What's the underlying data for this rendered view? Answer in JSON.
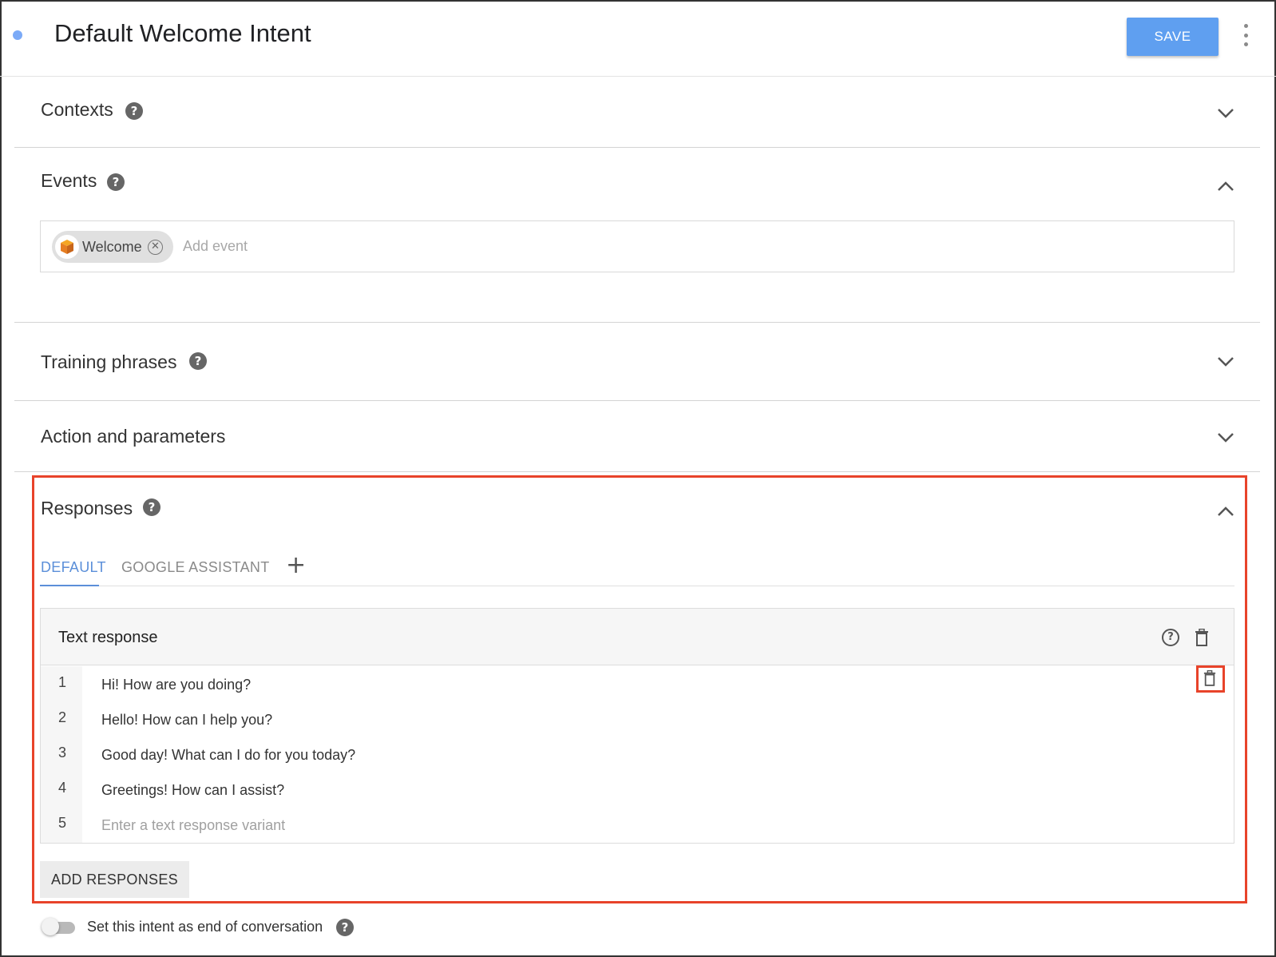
{
  "header": {
    "title": "Default Welcome Intent",
    "save_label": "SAVE"
  },
  "sections": {
    "contexts": "Contexts",
    "events": "Events",
    "training": "Training phrases",
    "action": "Action and parameters",
    "responses": "Responses"
  },
  "events": {
    "chip_label": "Welcome",
    "add_placeholder": "Add event"
  },
  "responses": {
    "tabs": [
      "DEFAULT",
      "GOOGLE ASSISTANT"
    ],
    "active_tab": "DEFAULT",
    "add_tab_symbol": "+",
    "card_title": "Text response",
    "rows": [
      {
        "num": "1",
        "text": "Hi! How are you doing?"
      },
      {
        "num": "2",
        "text": "Hello! How can I help you?"
      },
      {
        "num": "3",
        "text": "Good day! What can I do for you today?"
      },
      {
        "num": "4",
        "text": "Greetings! How can I assist?"
      }
    ],
    "new_row": {
      "num": "5",
      "placeholder": "Enter a text response variant"
    },
    "add_button": "ADD RESPONSES"
  },
  "end_conversation": {
    "label": "Set this intent as end of conversation",
    "enabled": false
  },
  "colors": {
    "accent": "#5f9ff0",
    "highlight": "#e8432a",
    "tab_active": "#5b8fd9"
  },
  "icons": [
    "help-icon",
    "chevron-down-icon",
    "chevron-up-icon",
    "remove-chip-icon",
    "event-cube-icon",
    "plus-icon",
    "trash-icon",
    "more-vert-icon"
  ]
}
